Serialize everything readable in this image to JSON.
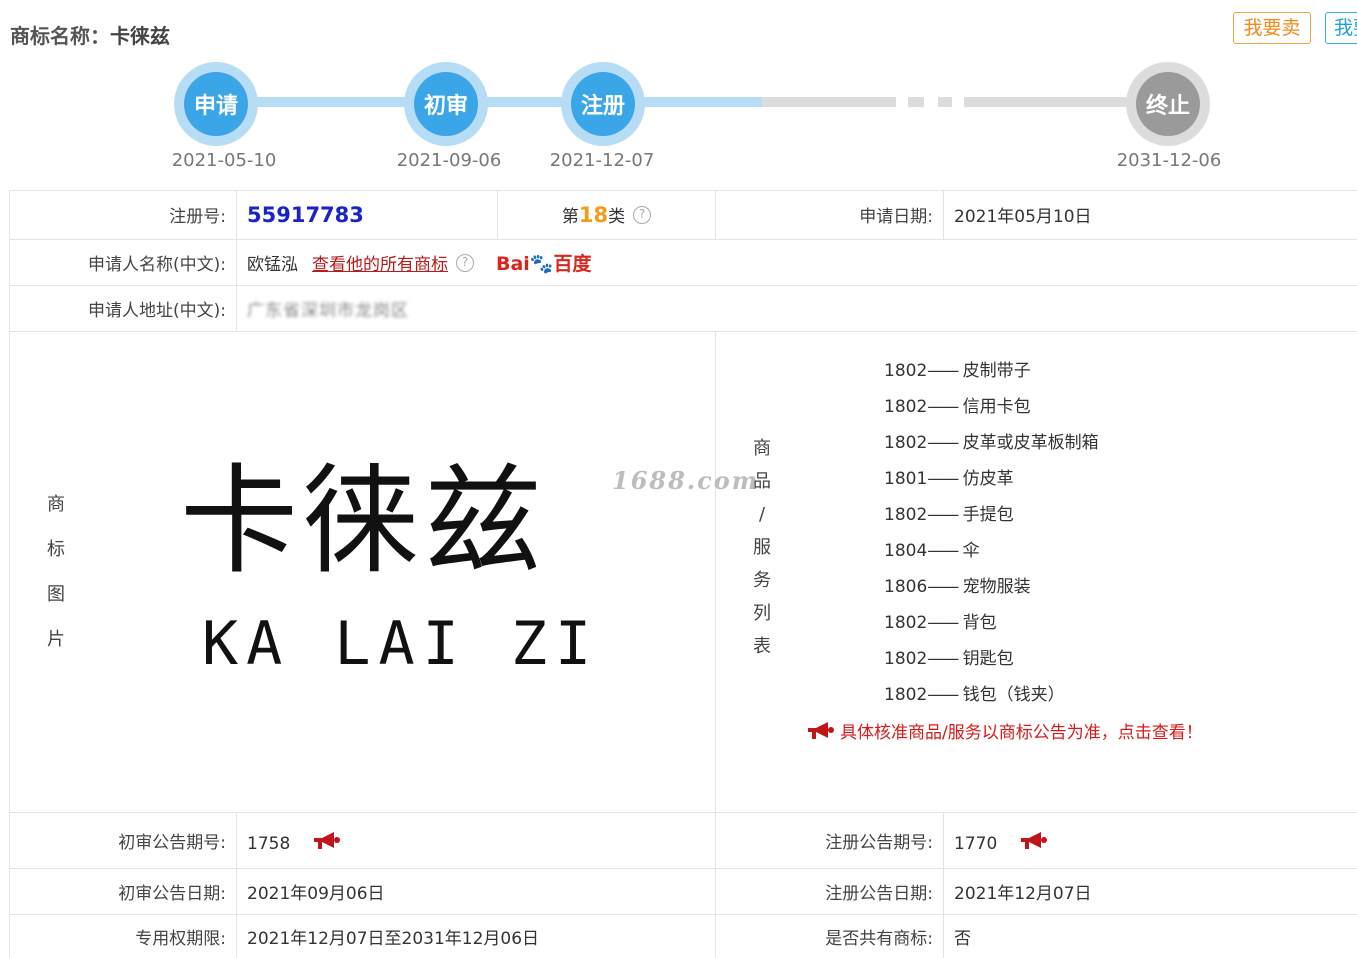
{
  "header": {
    "title_label": "商标名称：",
    "title_value": "卡徕兹",
    "sell_button": "我要卖",
    "buy_button": "我要买"
  },
  "timeline": [
    {
      "label": "申请",
      "date": "2021-05-10"
    },
    {
      "label": "初审",
      "date": "2021-09-06"
    },
    {
      "label": "注册",
      "date": "2021-12-07"
    },
    {
      "label": "终止",
      "date": "2031-12-06"
    }
  ],
  "info": {
    "reg_no_label": "注册号:",
    "reg_no": "55917783",
    "class_prefix": "第",
    "class_num": "18",
    "class_suffix": "类",
    "apply_date_label": "申请日期:",
    "apply_date": "2021年05月10日",
    "applicant_label": "申请人名称(中文):",
    "applicant": "欧锰泓",
    "view_all_link": "查看他的所有商标",
    "baidu_label": "Bai",
    "baidu_cn": "百度",
    "address_label": "申请人地址(中文):",
    "address": "广东省深圳市龙岗区"
  },
  "image_section": {
    "label_chars": [
      "商",
      "标",
      "图",
      "片"
    ],
    "trademark_cn": "卡徕兹",
    "trademark_en": "KA LAI ZI",
    "watermark": "1688.com"
  },
  "goods_section": {
    "label_chars": [
      "商",
      "品",
      "/",
      "服",
      "务",
      "列",
      "表"
    ],
    "items": [
      {
        "code": "1802",
        "name": "皮制带子"
      },
      {
        "code": "1802",
        "name": "信用卡包"
      },
      {
        "code": "1802",
        "name": "皮革或皮革板制箱"
      },
      {
        "code": "1801",
        "name": "仿皮革"
      },
      {
        "code": "1802",
        "name": "手提包"
      },
      {
        "code": "1804",
        "name": "伞"
      },
      {
        "code": "1806",
        "name": "宠物服装"
      },
      {
        "code": "1802",
        "name": "背包"
      },
      {
        "code": "1802",
        "name": "钥匙包"
      },
      {
        "code": "1802",
        "name": "钱包（钱夹）"
      }
    ],
    "dash": "——",
    "notice": "具体核准商品/服务以商标公告为准，点击查看！"
  },
  "bottom": {
    "prelim_no_label": "初审公告期号:",
    "prelim_no": "1758",
    "reg_pub_no_label": "注册公告期号:",
    "reg_pub_no": "1770",
    "prelim_date_label": "初审公告日期:",
    "prelim_date": "2021年09月06日",
    "reg_pub_date_label": "注册公告日期:",
    "reg_pub_date": "2021年12月07日",
    "exclusive_label": "专用权期限:",
    "exclusive_period": "2021年12月07日至2031年12月06日",
    "shared_label": "是否共有商标:",
    "shared_value": "否"
  },
  "colors": {
    "timeline_active": "#3aa6e8",
    "timeline_inactive": "#9a9a9a",
    "reg_no": "#1a23c8",
    "class_num": "#f59a1a",
    "notice": "#d71a1a"
  }
}
